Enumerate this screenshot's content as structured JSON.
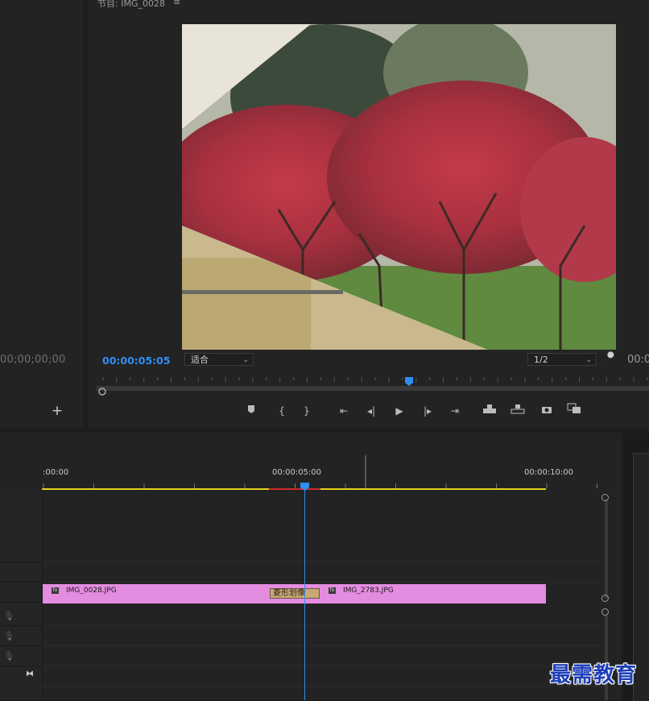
{
  "source_monitor": {
    "timecode": "00;00;00;00",
    "add_label": "+"
  },
  "program_monitor": {
    "title": "节目: IMG_0028",
    "menu_glyph": "≡",
    "current_timecode": "00:00:05:05",
    "zoom": "适合",
    "resolution": "1/2",
    "duration_timecode": "00:0",
    "playhead_fraction": 0.5
  },
  "transport": {
    "icons": [
      "marker-icon",
      "mark-in-icon",
      "mark-out-icon",
      "go-to-in-icon",
      "step-back-icon",
      "play-icon",
      "step-forward-icon",
      "go-to-out-icon",
      "lift-icon",
      "extract-icon",
      "export-frame-icon",
      "compare-view-icon"
    ]
  },
  "timeline": {
    "tc_0": ":00:00",
    "tc_5": "00:00:05:00",
    "tc_10": "00:00:10:00",
    "clips": [
      {
        "name": "IMG_0028.JPG",
        "fx": "fx"
      },
      {
        "name": "IMG_2783.JPG",
        "fx": "fx"
      }
    ],
    "transition": "菱形划像"
  },
  "watermark": "最需教育",
  "colors": {
    "accent": "#2f8ff5",
    "clip": "#e48ce0",
    "transition": "#c8a877",
    "work_area": "#e6d21e",
    "render_red": "#d22b2b"
  }
}
